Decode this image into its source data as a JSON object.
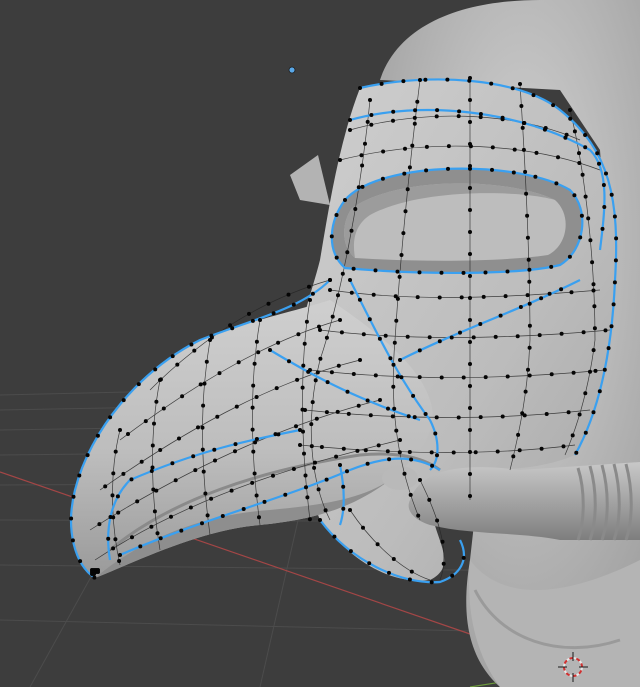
{
  "viewport": {
    "background": "#3d3d3d",
    "mesh_color": "#bdbdbd",
    "shadow_color": "#8e8e8e",
    "highlight_color": "#dadada",
    "wire_color": "#1f1f1f",
    "seam_color": "#3aa0f0",
    "vertex_color": "#050505",
    "grid_color": "#505050",
    "x_axis_color": "#b04848",
    "y_axis_color": "#6c9a3c"
  },
  "icons": {
    "light": "point-light-icon",
    "cursor": "3d-cursor-icon",
    "object": "plague-doctor-mask-mesh"
  }
}
